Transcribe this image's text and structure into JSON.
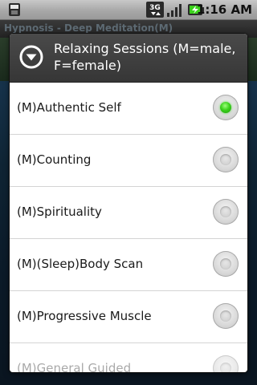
{
  "status_bar": {
    "time": "1:16 AM",
    "network_type": "3G",
    "icons": [
      "sd-card-icon",
      "network-3g-icon",
      "signal-icon",
      "battery-charging-icon"
    ]
  },
  "background_app": {
    "title": "Hypnosis - Deep Meditation(M)"
  },
  "dialog": {
    "title": "Relaxing Sessions (M=male, F=female)",
    "icon": "chevron-down-circle-icon",
    "items": [
      {
        "label": "(M)Authentic Self",
        "selected": true
      },
      {
        "label": "(M)Counting",
        "selected": false
      },
      {
        "label": "(M)Spirituality",
        "selected": false
      },
      {
        "label": "(M)(Sleep)Body Scan",
        "selected": false
      },
      {
        "label": "(M)Progressive Muscle",
        "selected": false
      },
      {
        "label": "(M)General Guided",
        "selected": false
      }
    ],
    "accent_color": "#3bd21c"
  }
}
